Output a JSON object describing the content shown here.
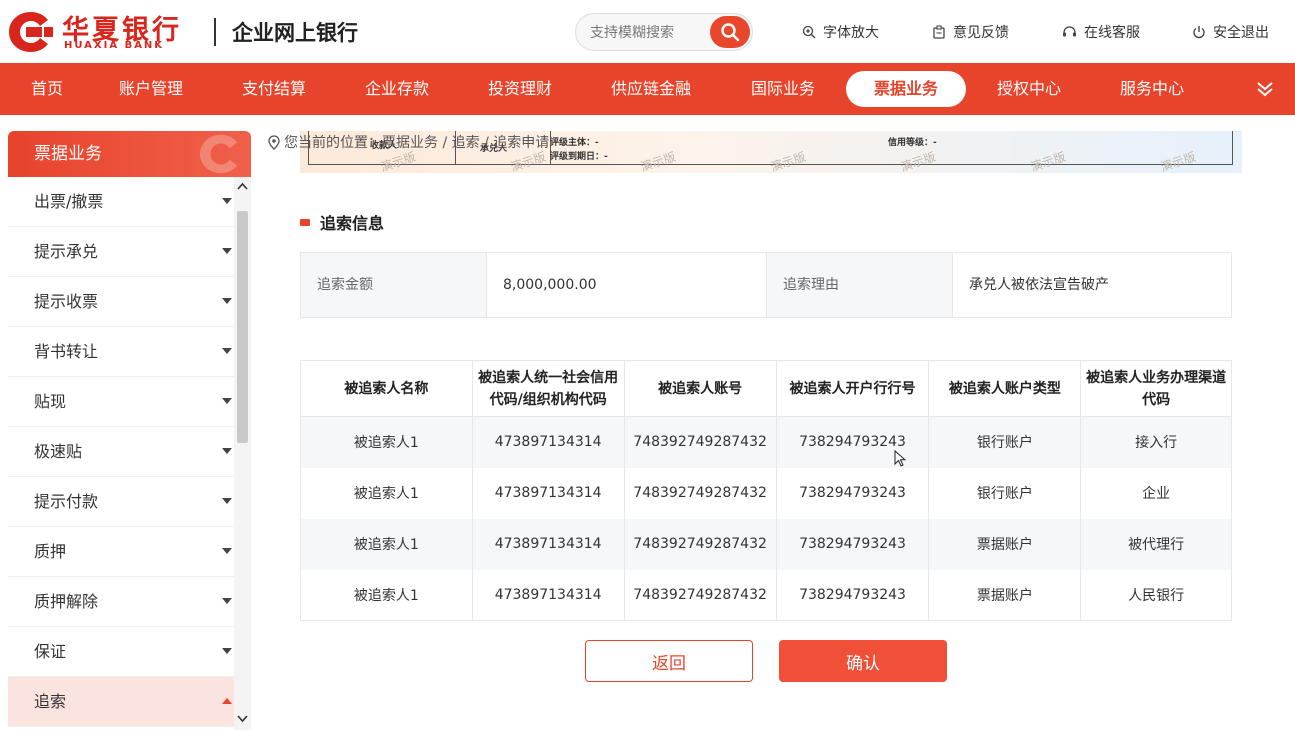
{
  "header": {
    "brand_cn": "华夏银行",
    "brand_en": "HUAXIA BANK",
    "subtitle": "企业网上银行",
    "search": {
      "placeholder": "支持模糊搜索"
    },
    "links": [
      {
        "label": "字体放大",
        "icon": "zoom-in-icon"
      },
      {
        "label": "意见反馈",
        "icon": "feedback-icon"
      },
      {
        "label": "在线客服",
        "icon": "headset-icon"
      },
      {
        "label": "安全退出",
        "icon": "power-icon"
      }
    ]
  },
  "nav": {
    "items": [
      "首页",
      "账户管理",
      "支付结算",
      "企业存款",
      "投资理财",
      "供应链金融",
      "国际业务",
      "票据业务",
      "授权中心",
      "服务中心"
    ],
    "active": "票据业务"
  },
  "sidebar": {
    "title": "票据业务",
    "items": [
      "出票/撤票",
      "提示承兑",
      "提示收票",
      "背书转让",
      "贴现",
      "极速贴",
      "提示付款",
      "质押",
      "质押解除",
      "保证",
      "追索"
    ],
    "active": "追索"
  },
  "breadcrumb": {
    "text": "您当前的位置：票据业务 / 追索 / 追索申请"
  },
  "prev_card": {
    "row1": "评级主体：-",
    "row2": "评级到期日：-",
    "credit": "信用等级：-",
    "label_a": "承兑人",
    "label_b": "收款人",
    "watermark": "演示版"
  },
  "section": {
    "title": "追索信息"
  },
  "recourse": {
    "amount_label": "追索金额",
    "amount_value": "8,000,000.00",
    "reason_label": "追索理由",
    "reason_value": "承兑人被依法宣告破产"
  },
  "table": {
    "headers": [
      "被追索人名称",
      "被追索人统一社会信用代码/组织机构代码",
      "被追索人账号",
      "被追索人开户行行号",
      "被追索人账户类型",
      "被追索人业务办理渠道代码"
    ],
    "rows": [
      [
        "被追索人1",
        "473897134314",
        "748392749287432",
        "738294793243",
        "银行账户",
        "接入行"
      ],
      [
        "被追索人1",
        "473897134314",
        "748392749287432",
        "738294793243",
        "银行账户",
        "企业"
      ],
      [
        "被追索人1",
        "473897134314",
        "748392749287432",
        "738294793243",
        "票据账户",
        "被代理行"
      ],
      [
        "被追索人1",
        "473897134314",
        "748392749287432",
        "738294793243",
        "票据账户",
        "人民银行"
      ]
    ]
  },
  "buttons": {
    "back": "返回",
    "confirm": "确认"
  },
  "colors": {
    "brand": "#e8432b",
    "accent_light": "#fbe3e0"
  }
}
